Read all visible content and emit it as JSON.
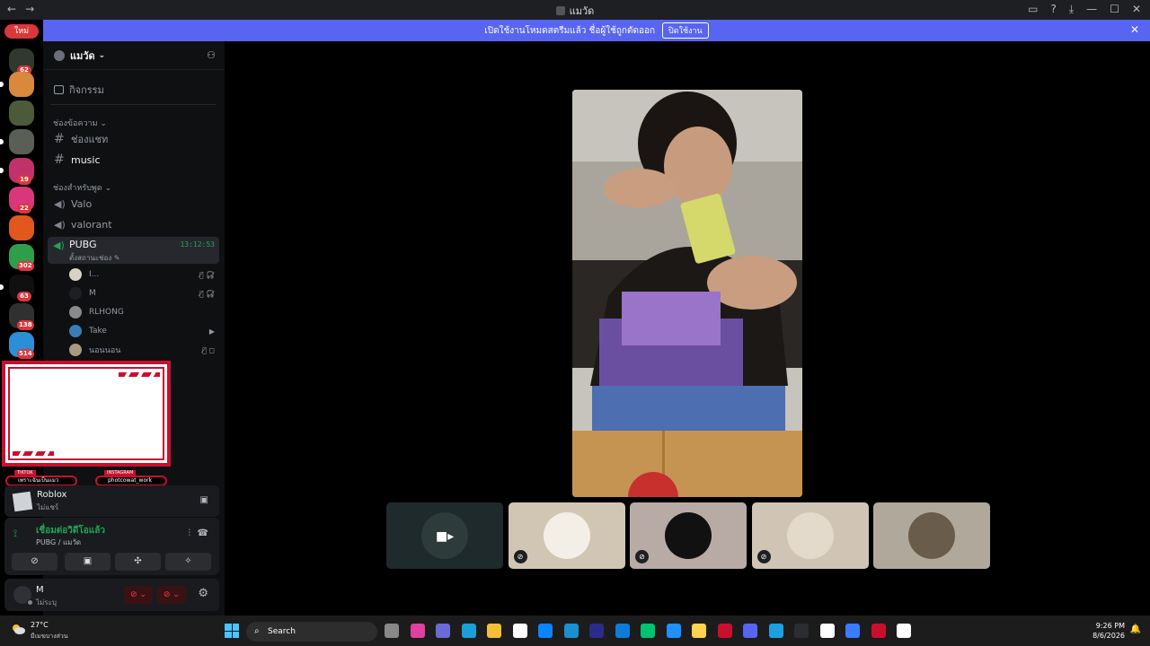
{
  "titlebar": {
    "back": "←",
    "forward": "→",
    "title": "แมวัด",
    "icons": [
      "inbox-icon",
      "help-icon",
      "download-icon",
      "minimize-icon",
      "maximize-icon",
      "close-icon"
    ],
    "glyphs": [
      "▭",
      "?",
      "⤓",
      "—",
      "☐",
      "✕"
    ]
  },
  "banner": {
    "text": "เปิดใช้งานโหมดสตรีมแล้ว ชื่อผู้ใช้ถูกตัดออก",
    "button": "ปิดใช้งาน",
    "close": "✕"
  },
  "rail": {
    "new_label": "ใหม่",
    "servers": [
      {
        "badge": "62",
        "color": "#2e3b2c"
      },
      {
        "badge": "",
        "color": "#d9893b"
      },
      {
        "badge": "",
        "color": "#4d5a3a"
      },
      {
        "badge": "",
        "color": "#5a5f55"
      },
      {
        "badge": "19",
        "color": "#c2326a"
      },
      {
        "badge": "22",
        "color": "#d8387a"
      },
      {
        "badge": "",
        "color": "#e1571c"
      },
      {
        "badge": "302",
        "color": "#2f9e4a"
      },
      {
        "badge": "63",
        "color": "#101010"
      },
      {
        "badge": "138",
        "color": "#303030"
      },
      {
        "badge": "514",
        "color": "#2a8fd6"
      }
    ]
  },
  "sidebar": {
    "guild_name": "แมวัด",
    "events": "กิจกรรม",
    "text_category": "ช่องข้อความ",
    "text_channels": [
      "ช่องแชท",
      "music"
    ],
    "voice_category": "ช่องสำหรับพูด",
    "voice_channels": [
      "Valo",
      "valorant"
    ],
    "active_channel": {
      "name": "PUBG",
      "timer": "13:12:53",
      "status": "ตั้งสถานะช่อง ✎"
    },
    "voice_users": [
      {
        "name": "I...",
        "icons": "🎙̸ 🎧̸",
        "color": "#d8d2c4"
      },
      {
        "name": "M",
        "icons": "🎙̸ 🎧̸",
        "color": "#1e1f22"
      },
      {
        "name": "RLHONG",
        "icons": "",
        "color": "#8a8a8a"
      },
      {
        "name": "Take",
        "icons": "▶",
        "color": "#3a7cb8"
      },
      {
        "name": "นอนนอน",
        "icons": "🎙̸ ◻",
        "color": "#a89a80"
      }
    ]
  },
  "overlay": {
    "tiktok_tag": "TIKTOK",
    "tiktok_handle": "เพราะฉันเป็นแมว",
    "instagram_tag": "INSTAGRAM",
    "instagram_handle": "photcowat_work"
  },
  "activity": {
    "game": "Roblox",
    "status": "ไม่แชร์"
  },
  "voice_panel": {
    "status": "เชื่อมต่อวิดีโอแล้ว",
    "location": "PUBG / แมวัด"
  },
  "user_panel": {
    "name": "M",
    "status": "ไม่ระบุ"
  },
  "stage": {
    "tiles": [
      {
        "bg": "#1e2a2c",
        "avatar": "#2d3b3a",
        "camera_off": true,
        "muted": false
      },
      {
        "bg": "#d1c6b3",
        "avatar": "#f3efe7",
        "camera_off": false,
        "muted": true
      },
      {
        "bg": "#b8aba6",
        "avatar": "#111111",
        "camera_off": false,
        "muted": true
      },
      {
        "bg": "#d0c5b4",
        "avatar": "#e3dacb",
        "camera_off": false,
        "muted": true
      },
      {
        "bg": "#b0a89a",
        "avatar": "#6a5c4a",
        "camera_off": false,
        "muted": false
      }
    ]
  },
  "taskbar": {
    "temperature": "27°C",
    "weather": "มีเมฆบางส่วน",
    "search_placeholder": "Search",
    "time": "9:26 PM",
    "date": "8/6/2026",
    "apps": [
      "#888888",
      "#e040a0",
      "#6b6bd6",
      "#1a9fd8",
      "#f2c037",
      "#ffffff",
      "#0a84ff",
      "#1b8fd0",
      "#2b2b8a",
      "#0f7bd8",
      "#00c26f",
      "#1e90ff",
      "#ffd34d",
      "#c8102e",
      "#5865f2",
      "#1ba1e2",
      "#2b2d31",
      "#ffffff",
      "#3b7bff",
      "#c8102e",
      "#ffffff"
    ]
  }
}
